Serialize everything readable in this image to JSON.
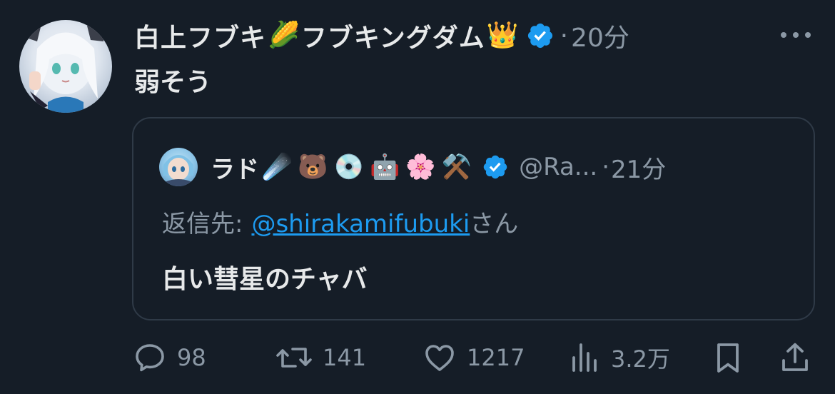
{
  "tweet": {
    "display_name_1": "白上フブキ",
    "emoji_1": "🌽",
    "display_name_2": "フブキングダム",
    "emoji_2": "👑",
    "dot": "·",
    "time": "20分",
    "text": "弱そう"
  },
  "quote": {
    "name": "ラド",
    "emojis": [
      "☄️",
      "🐻",
      "💿",
      "🤖",
      "🌸",
      "⚒️"
    ],
    "handle": "@Ra...",
    "dot": "·",
    "time": "21分",
    "reply_prefix": "返信先:",
    "reply_mention": "@shirakamifubuki",
    "reply_suffix": "さん",
    "text": "白い彗星のチャバ"
  },
  "actions": {
    "replies": "98",
    "retweets": "141",
    "likes": "1217",
    "views": "3.2万"
  },
  "colors": {
    "background": "#151d27",
    "text_primary": "#e7e9ea",
    "text_secondary": "#8b98a5",
    "link": "#1d9bf0",
    "verified": "#1d9bf0",
    "border": "#2f3a47"
  }
}
